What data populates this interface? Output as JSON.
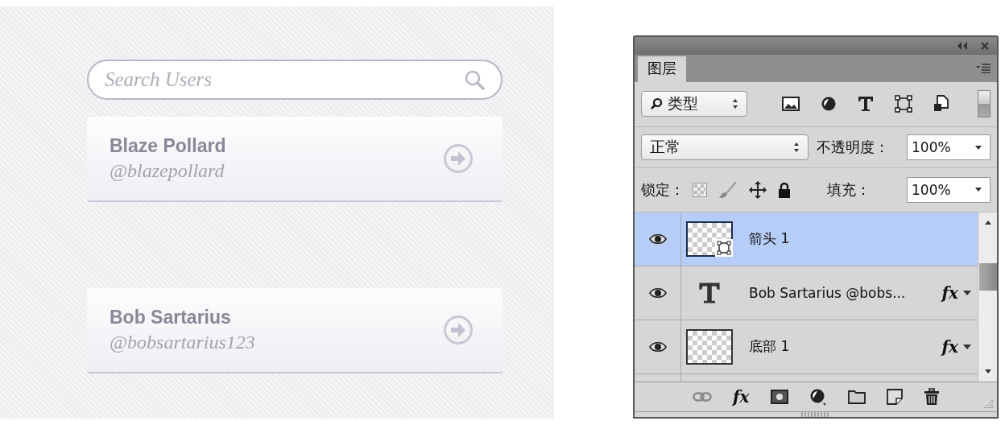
{
  "canvas": {
    "search": {
      "placeholder": "Search Users"
    },
    "users": [
      {
        "name": "Blaze Pollard",
        "handle": "@blazepollard"
      },
      {
        "name": "Bob Sartarius",
        "handle": "@bobsartarius123"
      }
    ]
  },
  "panel": {
    "tabs": [
      {
        "label": "图层",
        "selected": true
      }
    ],
    "filter": {
      "value": "类型"
    },
    "blend_mode": {
      "value": "正常"
    },
    "opacity": {
      "label": "不透明度：",
      "value": "100%"
    },
    "lock": {
      "label": "锁定："
    },
    "fill": {
      "label": "填充：",
      "value": "100%"
    },
    "layers": [
      {
        "name": "箭头 1",
        "kind": "shape",
        "selected": true,
        "visible": true
      },
      {
        "name": "Bob Sartarius @bobs...",
        "kind": "text",
        "selected": false,
        "visible": true,
        "effects": "fx"
      },
      {
        "name": "底部 1",
        "kind": "raster",
        "selected": false,
        "visible": true,
        "effects": "fx"
      }
    ],
    "footer": {
      "effects": "fx"
    }
  }
}
